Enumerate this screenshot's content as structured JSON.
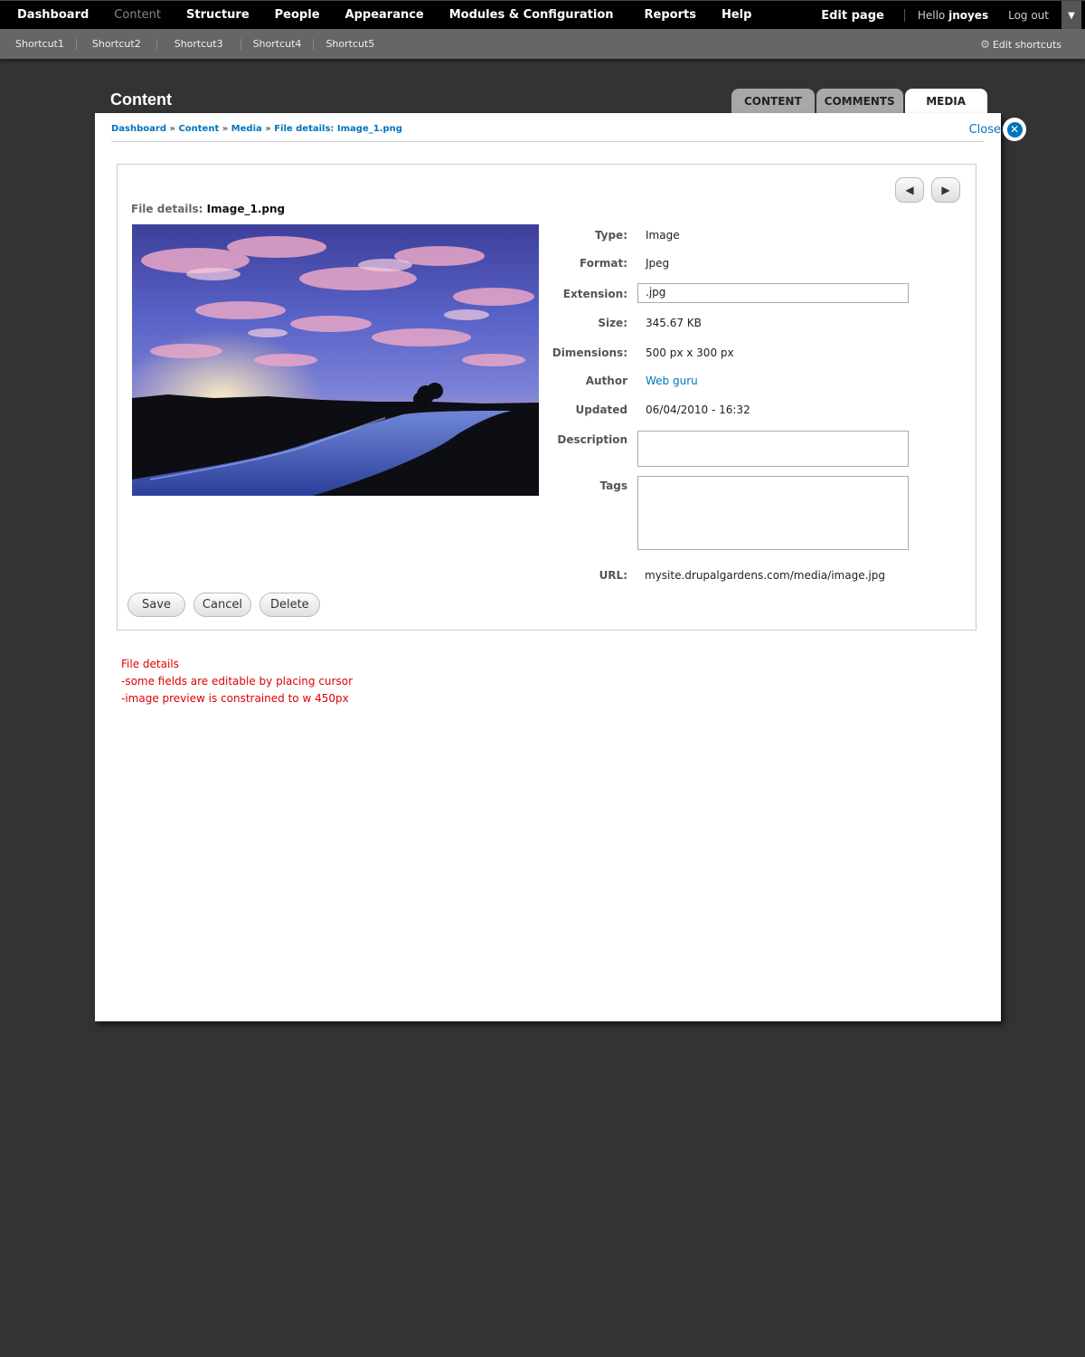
{
  "toolbar": {
    "nav": [
      "Dashboard",
      "Content",
      "Structure",
      "People",
      "Appearance",
      "Modules & Configuration",
      "Reports",
      "Help"
    ],
    "edit_page": "Edit page",
    "hello_prefix": "Hello",
    "username": "jnoyes",
    "logout": "Log out"
  },
  "shortcuts": {
    "items": [
      "Shortcut1",
      "Shortcut2",
      "Shortcut3",
      "Shortcut4",
      "Shortcut5"
    ],
    "edit_label": "Edit shortcuts"
  },
  "overlay": {
    "title": "Content",
    "tabs": [
      "CONTENT",
      "COMMENTS",
      "MEDIA"
    ],
    "active_tab": "MEDIA",
    "close_label": "Close"
  },
  "breadcrumb": {
    "items": [
      "Dashboard",
      "Content",
      "Media",
      "File details: Image_1.png"
    ],
    "separator": "»"
  },
  "file": {
    "heading_label": "File details:",
    "filename": "Image_1.png",
    "fields": {
      "type": {
        "label": "Type:",
        "value": "Image"
      },
      "format": {
        "label": "Format:",
        "value": "Jpeg"
      },
      "extension": {
        "label": "Extension:",
        "value": ".jpg"
      },
      "size": {
        "label": "Size:",
        "value": "345.67 KB"
      },
      "dimensions": {
        "label": "Dimensions:",
        "value": "500 px x 300 px"
      },
      "author": {
        "label": "Author",
        "value": "Web guru"
      },
      "updated": {
        "label": "Updated",
        "value": "06/04/2010 - 16:32"
      },
      "description": {
        "label": "Description",
        "value": ""
      },
      "tags": {
        "label": "Tags",
        "value": ""
      },
      "url": {
        "label": "URL:",
        "value": "mysite.drupalgardens.com/media/image.jpg"
      }
    }
  },
  "actions": {
    "save": "Save",
    "cancel": "Cancel",
    "delete": "Delete"
  },
  "notes": [
    "File details",
    "-some fields are editable by placing cursor",
    "-image preview is constrained to w 450px"
  ],
  "colors": {
    "link": "#0074bd",
    "note": "#e00000",
    "background": "#333333"
  }
}
